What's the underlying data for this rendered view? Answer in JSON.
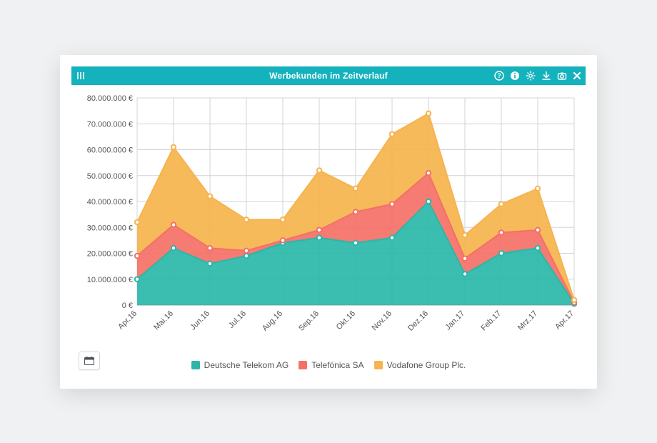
{
  "header": {
    "title": "Werbekunden im Zeitverlauf"
  },
  "toolbar_icons": {
    "menu": "menu-icon",
    "help": "help-icon",
    "info": "info-icon",
    "settings": "settings-icon",
    "download": "download-icon",
    "snapshot": "snapshot-icon",
    "close": "close-icon"
  },
  "calendar_btn_label": "calendar",
  "chart_data": {
    "type": "area",
    "stacked": true,
    "title": "Werbekunden im Zeitverlauf",
    "xlabel": "",
    "ylabel": "",
    "ylim": [
      0,
      80000000
    ],
    "y_ticks": [
      "0 €",
      "10.000.000 €",
      "20.000.000 €",
      "30.000.000 €",
      "40.000.000 €",
      "50.000.000 €",
      "60.000.000 €",
      "70.000.000 €",
      "80.000.000 €"
    ],
    "categories": [
      "Apr.16",
      "Mai.16",
      "Jun.16",
      "Jul.16",
      "Aug.16",
      "Sep.16",
      "Okt.16",
      "Nov.16",
      "Dez.16",
      "Jan.17",
      "Feb.17",
      "Mrz.17",
      "Apr.17"
    ],
    "series": [
      {
        "name": "Deutsche Telekom AG",
        "color": "#2ab7a9",
        "values": [
          10000000,
          22000000,
          16000000,
          19000000,
          24000000,
          26000000,
          24000000,
          26000000,
          40000000,
          12000000,
          20000000,
          22000000,
          500000
        ]
      },
      {
        "name": "Telefónica SA",
        "color": "#f47067",
        "values": [
          9000000,
          9000000,
          6000000,
          2000000,
          1000000,
          3000000,
          12000000,
          13000000,
          11000000,
          6000000,
          8000000,
          7000000,
          500000
        ]
      },
      {
        "name": "Vodafone Group Plc.",
        "color": "#f5b44d",
        "values": [
          13000000,
          30000000,
          20000000,
          12000000,
          8000000,
          23000000,
          9000000,
          27000000,
          23000000,
          9000000,
          11000000,
          16000000,
          1000000
        ]
      }
    ],
    "legend_position": "bottom"
  }
}
